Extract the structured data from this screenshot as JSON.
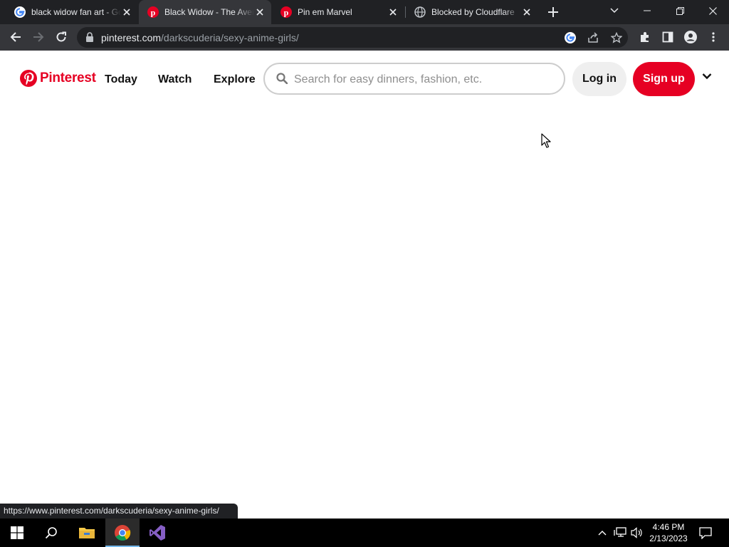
{
  "browser": {
    "tabs": [
      {
        "title": "black widow fan art - Google Search",
        "favicon": "google-icon",
        "active": false
      },
      {
        "title": "Black Widow - The Avengers",
        "favicon": "pinterest-icon",
        "active": true
      },
      {
        "title": "Pin em Marvel",
        "favicon": "pinterest-icon",
        "active": false
      },
      {
        "title": "Blocked by Cloudflare",
        "favicon": "globe-icon",
        "active": false
      }
    ],
    "address": {
      "host": "pinterest.com",
      "path": "/darkscuderia/sexy-anime-girls/"
    },
    "status_url": "https://www.pinterest.com/darkscuderia/sexy-anime-girls/"
  },
  "pinterest": {
    "logo_text": "Pinterest",
    "nav": {
      "today": "Today",
      "watch": "Watch",
      "explore": "Explore"
    },
    "search": {
      "placeholder": "Search for easy dinners, fashion, etc."
    },
    "login_label": "Log in",
    "signup_label": "Sign up",
    "brand_color": "#e60023"
  },
  "taskbar": {
    "time": "4:46 PM",
    "date": "2/13/2023"
  }
}
